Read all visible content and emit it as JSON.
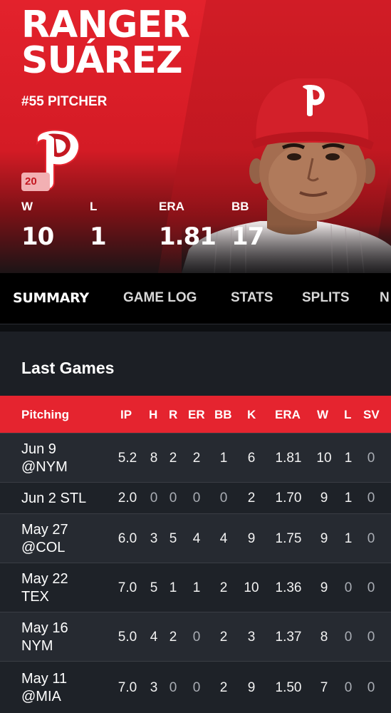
{
  "player": {
    "first_name": "RANGER",
    "last_name": "SUÁREZ",
    "meta": "#55 PITCHER",
    "year_tag": "20"
  },
  "stats": [
    {
      "label": "W",
      "value": "10"
    },
    {
      "label": "L",
      "value": "1"
    },
    {
      "label": "ERA",
      "value": "1.81"
    },
    {
      "label": "BB",
      "value": "17"
    }
  ],
  "tabs": [
    "SUMMARY",
    "GAME LOG",
    "STATS",
    "SPLITS",
    "N"
  ],
  "section": {
    "title": "Last Games",
    "columns": [
      "Pitching",
      "IP",
      "H",
      "R",
      "ER",
      "BB",
      "K",
      "ERA",
      "W",
      "L",
      "SV"
    ],
    "rows": [
      {
        "game": [
          "Jun 9",
          "@NYM"
        ],
        "values": [
          "5.2",
          "8",
          "2",
          "2",
          "1",
          "6",
          "1.81",
          "10",
          "1",
          "0"
        ]
      },
      {
        "game": [
          "Jun 2 STL"
        ],
        "values": [
          "2.0",
          "0",
          "0",
          "0",
          "0",
          "2",
          "1.70",
          "9",
          "1",
          "0"
        ]
      },
      {
        "game": [
          "May 27",
          "@COL"
        ],
        "values": [
          "6.0",
          "3",
          "5",
          "4",
          "4",
          "9",
          "1.75",
          "9",
          "1",
          "0"
        ]
      },
      {
        "game": [
          "May 22",
          "TEX"
        ],
        "values": [
          "7.0",
          "5",
          "1",
          "1",
          "2",
          "10",
          "1.36",
          "9",
          "0",
          "0"
        ]
      },
      {
        "game": [
          "May 16",
          "NYM"
        ],
        "values": [
          "5.0",
          "4",
          "2",
          "0",
          "2",
          "3",
          "1.37",
          "8",
          "0",
          "0"
        ]
      },
      {
        "game": [
          "May 11",
          "@MIA"
        ],
        "values": [
          "7.0",
          "3",
          "0",
          "0",
          "2",
          "9",
          "1.50",
          "7",
          "0",
          "0"
        ]
      }
    ]
  },
  "colors": {
    "team_red": "#e5242f",
    "dark_bg": "#1c1f25"
  },
  "icons": {
    "team_logo": "phillies-p-logo",
    "player_photo": "player-headshot"
  }
}
